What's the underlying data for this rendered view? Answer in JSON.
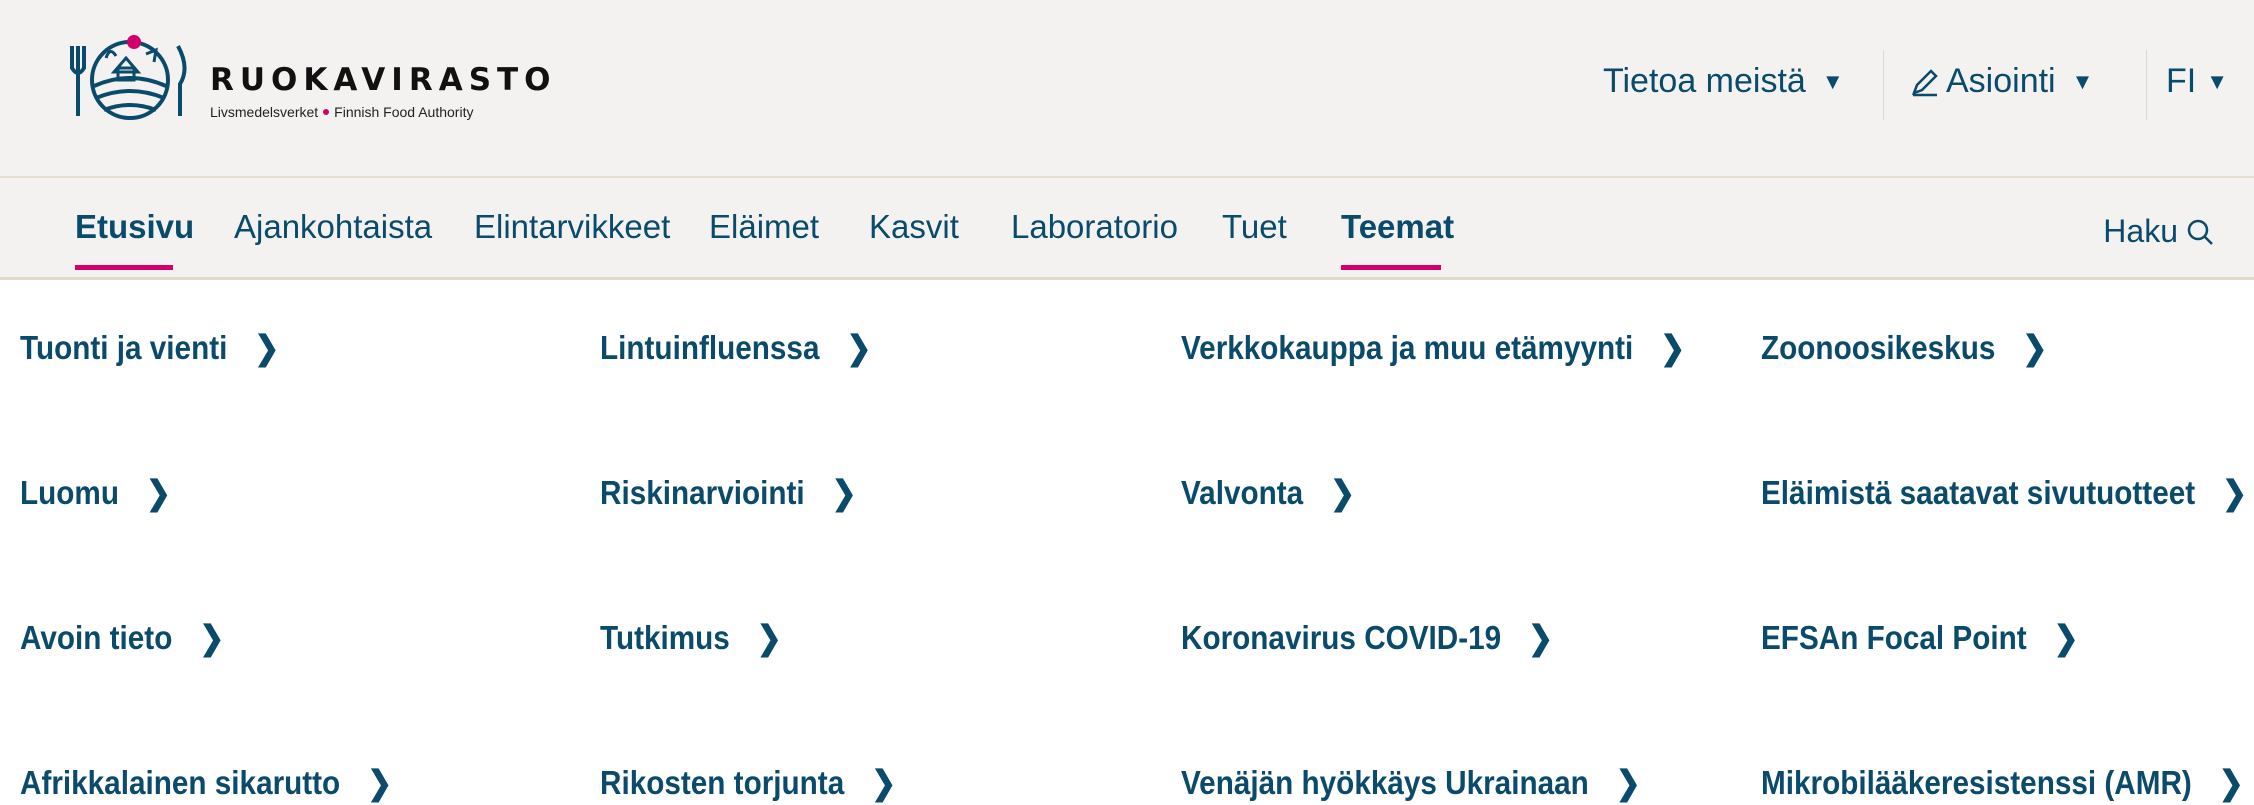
{
  "brand": {
    "name": "RUOKAVIRASTO",
    "sub_left": "Livsmedelsverket",
    "sub_right": "Finnish Food Authority"
  },
  "utility_nav": {
    "about": "Tietoa meistä",
    "services": "Asiointi",
    "language": "FI"
  },
  "main_nav": {
    "items": [
      "Etusivu",
      "Ajankohtaista",
      "Elintarvikkeet",
      "Eläimet",
      "Kasvit",
      "Laboratorio",
      "Tuet",
      "Teemat"
    ],
    "active": [
      "Etusivu",
      "Teemat"
    ],
    "search_label": "Haku"
  },
  "themes_menu": {
    "columns": [
      [
        "Tuonti ja vienti",
        "Luomu",
        "Avoin tieto",
        "Afrikkalainen sikarutto"
      ],
      [
        "Lintuinfluenssa",
        "Riskinarviointi",
        "Tutkimus",
        "Rikosten torjunta"
      ],
      [
        "Verkkokauppa ja muu etämyynti",
        "Valvonta",
        "Koronavirus COVID-19",
        "Venäjän hyökkäys Ukrainaan"
      ],
      [
        "Zoonoosikeskus",
        "Eläimistä saatavat sivutuotteet",
        "EFSAn Focal Point",
        "Mikrobilääkeresistenssi (AMR)"
      ]
    ]
  },
  "colors": {
    "accent": "#d3006b",
    "text": "#0a4a6a",
    "header_bg": "#f3f2f0"
  },
  "icons": {
    "chevron": "›",
    "caret": "▼"
  }
}
